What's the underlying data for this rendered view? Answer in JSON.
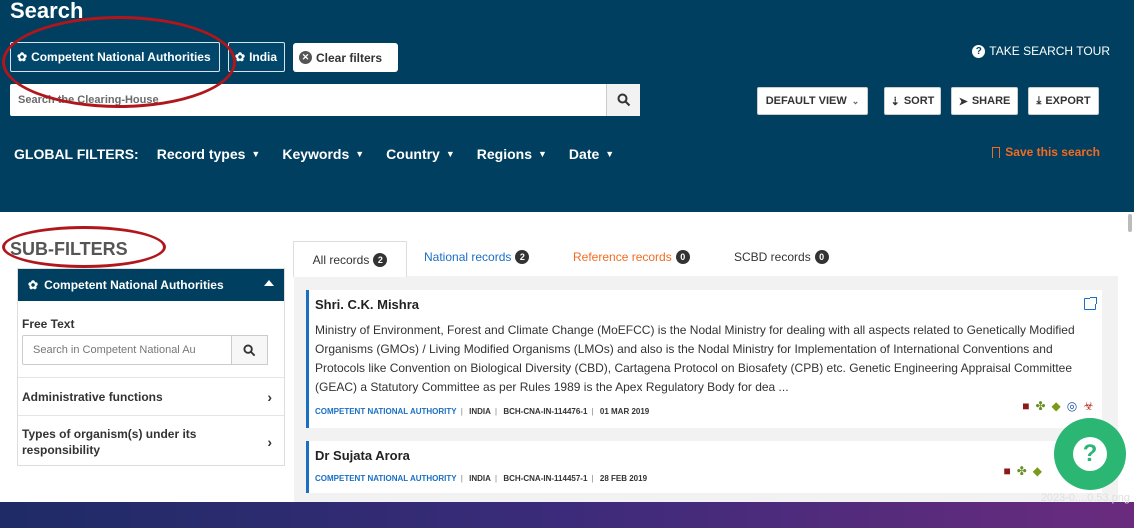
{
  "header": {
    "title": "Search",
    "chips": {
      "cna_label": "Competent National Authorities",
      "india_label": "India"
    },
    "clear_filters": "Clear filters",
    "take_tour": "TAKE SEARCH TOUR",
    "search_placeholder": "Search the Clearing-House",
    "buttons": {
      "default_view": "DEFAULT VIEW",
      "sort": "SORT",
      "share": "SHARE",
      "export": "EXPORT"
    },
    "global_filters": {
      "label": "GLOBAL FILTERS:",
      "items": [
        "Record types",
        "Keywords",
        "Country",
        "Regions",
        "Date"
      ]
    },
    "save_search": "Save this search"
  },
  "sub_filters": {
    "title": "SUB-FILTERS",
    "panel_title": "Competent National Authorities",
    "free_text_label": "Free Text",
    "free_text_placeholder": "Search in Competent National Au",
    "rows": [
      "Administrative functions",
      "Types of organism(s) under its responsibility"
    ]
  },
  "tabs": [
    {
      "label": "All records",
      "count": "2"
    },
    {
      "label": "National records",
      "count": "2"
    },
    {
      "label": "Reference records",
      "count": "0"
    },
    {
      "label": "SCBD records",
      "count": "0"
    }
  ],
  "records": [
    {
      "name": "Shri. C.K. Mishra",
      "description": "Ministry of Environment, Forest and Climate Change (MoEFCC) is the Nodal Ministry for dealing with all aspects related to Genetically Modified Organisms (GMOs) / Living Modified Organisms (LMOs) and also is the Nodal Ministry for Implementation of International Conventions and Protocols like Convention on Biological Diversity (CBD), Cartagena Protocol on Biosafety (CPB) etc. Genetic Engineering Appraisal Committee (GEAC) a Statutory Committee as per Rules 1989 is the Apex Regulatory Body for dea ...",
      "type": "COMPETENT NATIONAL AUTHORITY",
      "country": "INDIA",
      "id": "BCH-CNA-IN-114476-1",
      "date": "01 MAR 2019"
    },
    {
      "name": "Dr Sujata Arora",
      "type": "COMPETENT NATIONAL AUTHORITY",
      "country": "INDIA",
      "id": "BCH-CNA-IN-114457-1",
      "date": "28 FEB 2019"
    }
  ],
  "filename": "2023-0....0.53.png",
  "colors": {
    "header_bg": "#003f5f",
    "accent_blue": "#1a6fc4",
    "accent_orange": "#f26b21",
    "highlight_red": "#b0161c",
    "help_green": "#2bb673"
  }
}
